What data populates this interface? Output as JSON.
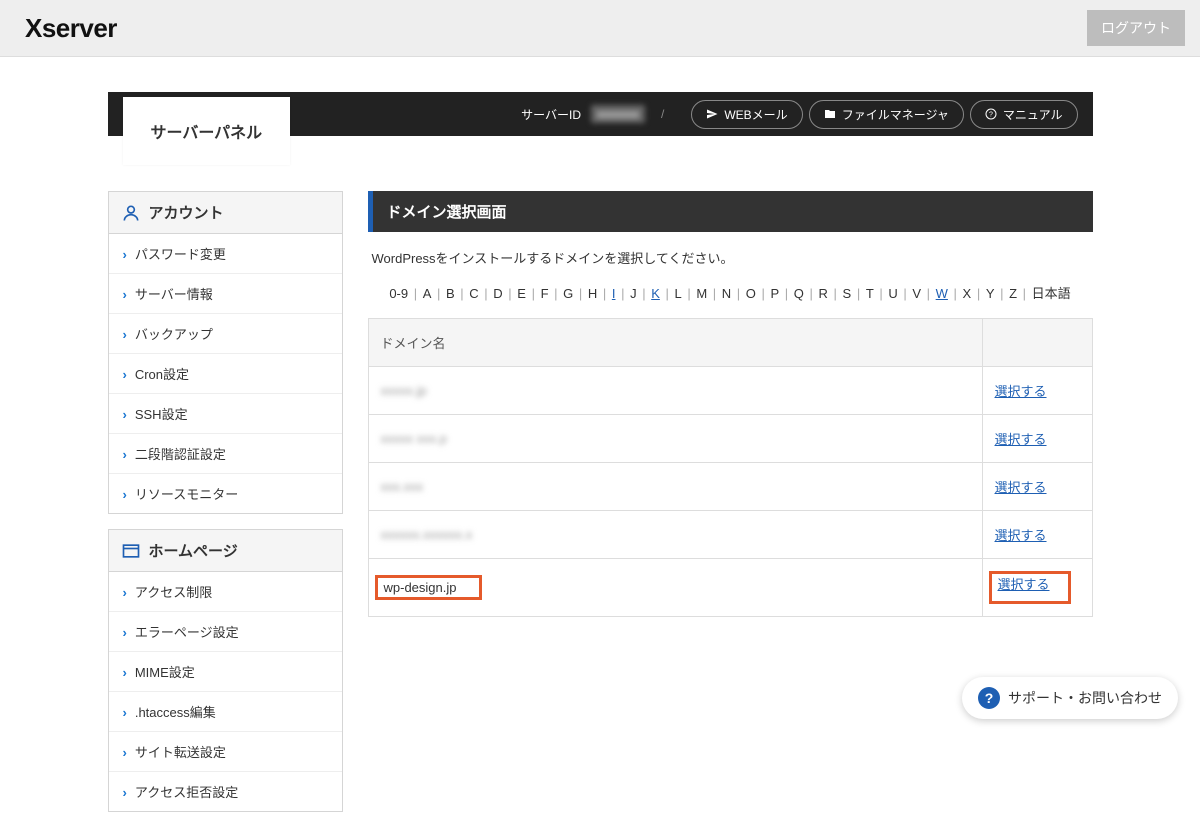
{
  "header": {
    "logo": "Xserver",
    "logout": "ログアウト"
  },
  "blackbar": {
    "panel_title": "サーバーパネル",
    "server_id_label": "サーバーID",
    "server_id_value": "xxxxxxx",
    "webmail": "WEBメール",
    "filemanager": "ファイルマネージャ",
    "manual": "マニュアル"
  },
  "sidebar": {
    "account": {
      "title": "アカウント",
      "items": [
        "パスワード変更",
        "サーバー情報",
        "バックアップ",
        "Cron設定",
        "SSH設定",
        "二段階認証設定",
        "リソースモニター"
      ]
    },
    "homepage": {
      "title": "ホームページ",
      "items": [
        "アクセス制限",
        "エラーページ設定",
        "MIME設定",
        ".htaccess編集",
        "サイト転送設定",
        "アクセス拒否設定"
      ]
    }
  },
  "main": {
    "title": "ドメイン選択画面",
    "description": "WordPressをインストールするドメインを選択してください。",
    "alpha": [
      "0-9",
      "A",
      "B",
      "C",
      "D",
      "E",
      "F",
      "G",
      "H",
      "I",
      "J",
      "K",
      "L",
      "M",
      "N",
      "O",
      "P",
      "Q",
      "R",
      "S",
      "T",
      "U",
      "V",
      "W",
      "X",
      "Y",
      "Z",
      "日本語"
    ],
    "alpha_highlight": [
      "I",
      "K",
      "W"
    ],
    "table_header_domain": "ドメイン名",
    "select_label": "選択する",
    "rows": [
      {
        "domain": "xxxxx.jp",
        "blur": true,
        "highlight": false
      },
      {
        "domain": "xxxxx xxx.p",
        "blur": true,
        "highlight": false
      },
      {
        "domain": "xxx.xxx",
        "blur": true,
        "highlight": false
      },
      {
        "domain": "xxxxxx.xxxxxx.x",
        "blur": true,
        "highlight": false
      },
      {
        "domain": "wp-design.jp",
        "blur": false,
        "highlight": true
      }
    ]
  },
  "support_fab": "サポート・お問い合わせ"
}
